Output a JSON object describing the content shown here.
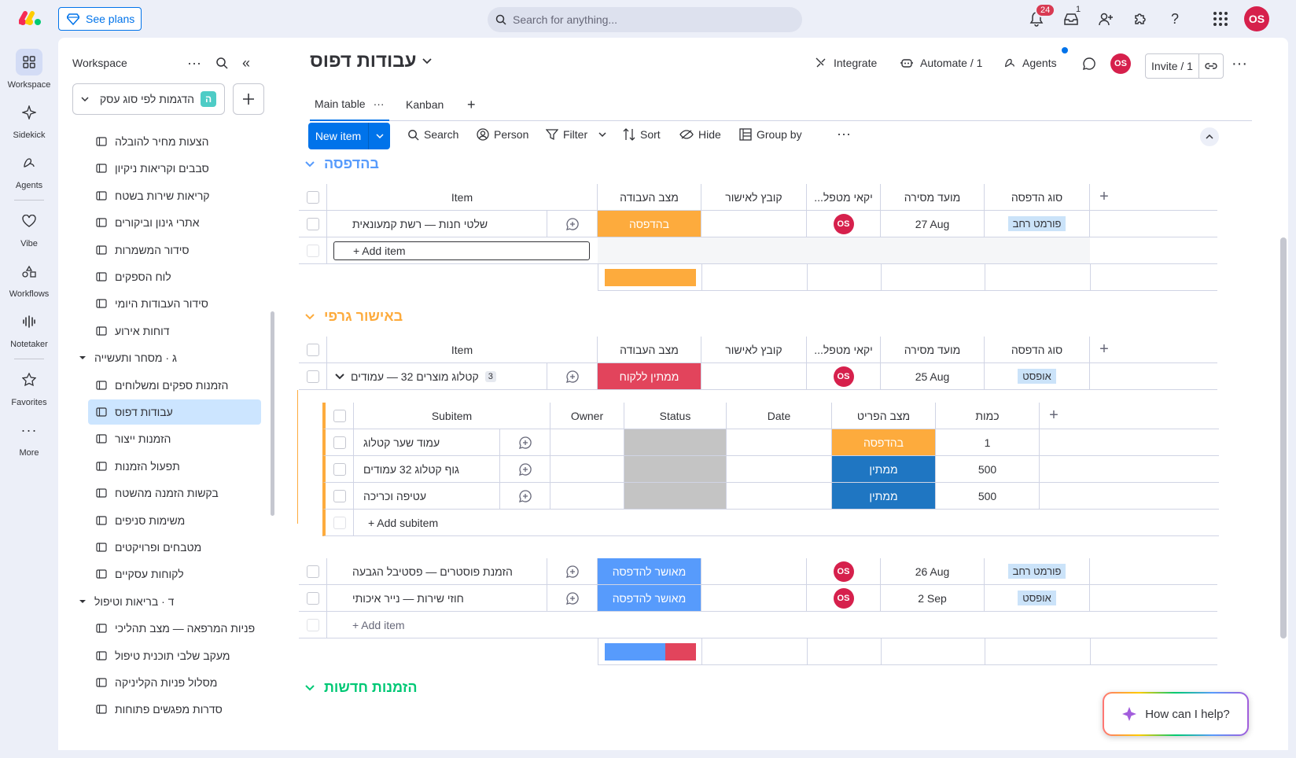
{
  "topbar": {
    "see_plans": "See plans",
    "search_placeholder": "Search for anything...",
    "notifications_count": "24",
    "inbox_count": "1",
    "user_initials": "OS"
  },
  "rail": {
    "items": [
      {
        "label": "Workspace",
        "icon": "grid-icon"
      },
      {
        "label": "Sidekick",
        "icon": "sparkle-icon"
      },
      {
        "label": "Agents",
        "icon": "agents-icon"
      },
      {
        "label": "Vibe",
        "icon": "heart-icon"
      },
      {
        "label": "Workflows",
        "icon": "workflows-icon"
      },
      {
        "label": "Notetaker",
        "icon": "waveform-icon"
      },
      {
        "label": "Favorites",
        "icon": "star-icon"
      },
      {
        "label": "More",
        "icon": "more-icon"
      }
    ]
  },
  "sidebar": {
    "title": "Workspace",
    "workspace_name": "הדגמות לפי סוג עסק",
    "workspace_badge": "ה",
    "items": [
      {
        "label": "הצעות מחיר להובלה",
        "type": "board"
      },
      {
        "label": "סבבים וקריאות ניקיון",
        "type": "board"
      },
      {
        "label": "קריאות שירות בשטח",
        "type": "board"
      },
      {
        "label": "אתרי גינון וביקורים",
        "type": "board"
      },
      {
        "label": "סידור המשמרות",
        "type": "board"
      },
      {
        "label": "לוח הספקים",
        "type": "board"
      },
      {
        "label": "סידור העבודות היומי",
        "type": "board"
      },
      {
        "label": "דוחות אירוע",
        "type": "board"
      },
      {
        "label": "ג · מסחר ותעשייה",
        "type": "group"
      },
      {
        "label": "הזמנות ספקים ומשלוחים",
        "type": "board"
      },
      {
        "label": "עבודות דפוס",
        "type": "board",
        "active": true
      },
      {
        "label": "הזמנות ייצור",
        "type": "board"
      },
      {
        "label": "תפעול הזמנות",
        "type": "board"
      },
      {
        "label": "בקשות הזמנה מהשטח",
        "type": "board"
      },
      {
        "label": "משימות סניפים",
        "type": "board"
      },
      {
        "label": "מטבחים ופרויקטים",
        "type": "board"
      },
      {
        "label": "לקוחות עסקיים",
        "type": "board"
      },
      {
        "label": "ד · בריאות וטיפול",
        "type": "group"
      },
      {
        "label": "פניות המרפאה — מצב תהליכי",
        "type": "board"
      },
      {
        "label": "מעקב שלבי תוכנית טיפול",
        "type": "board"
      },
      {
        "label": "מסלול פניות הקליניקה",
        "type": "board"
      },
      {
        "label": "סדרות מפגשים פתוחות",
        "type": "board"
      }
    ]
  },
  "board": {
    "title": "עבודות דפוס",
    "integrate": "Integrate",
    "automate": "Automate / 1",
    "agents": "Agents",
    "invite": "Invite / 1",
    "tabs": [
      "Main table",
      "Kanban"
    ],
    "toolbar": {
      "new_item": "New item",
      "search": "Search",
      "person": "Person",
      "filter": "Filter",
      "sort": "Sort",
      "hide": "Hide",
      "group_by": "Group by"
    },
    "columns": [
      "Item",
      "מצב העבודה",
      "קובץ לאישור",
      "...יקאי מטפל",
      "מועד מסירה",
      "סוג הדפסה"
    ],
    "add_item": "+ Add item",
    "groups": [
      {
        "title": "בהדפסה",
        "color": "#579bfc",
        "rows": [
          {
            "name": "שלטי חנות — רשת קמעונאית",
            "status": "בהדפסה",
            "status_color": "#fdab3d",
            "owner": "OS",
            "date": "27 Aug",
            "type": "פורמט רחב"
          }
        ]
      },
      {
        "title": "באישור גרפי",
        "color": "#fdab3d",
        "rows": [
          {
            "name": "קטלוג מוצרים 32 — עמודים",
            "subitems_count": "3",
            "status": "ממתין ללקוח",
            "status_color": "#e2445c",
            "owner": "OS",
            "date": "25 Aug",
            "type": "אופסט"
          },
          {
            "name": "הזמנת פוסטרים — פסטיבל הגבעה",
            "status": "מאושר להדפסה",
            "status_color": "#579bfc",
            "owner": "OS",
            "date": "26 Aug",
            "type": "פורמט רחב"
          },
          {
            "name": "חוזי שירות — נייר איכותי",
            "status": "מאושר להדפסה",
            "status_color": "#579bfc",
            "owner": "OS",
            "date": "2 Sep",
            "type": "אופסט"
          }
        ],
        "subitems": {
          "columns": [
            "Subitem",
            "Owner",
            "Status",
            "Date",
            "מצב הפריט",
            "כמות"
          ],
          "rows": [
            {
              "name": "עמוד שער קטלוג",
              "state": "בהדפסה",
              "state_color": "#fdab3d",
              "qty": "1"
            },
            {
              "name": "גוף קטלוג 32 עמודים",
              "state": "ממתין",
              "state_color": "#1f76c2",
              "qty": "500"
            },
            {
              "name": "עטיפה וכריכה",
              "state": "ממתין",
              "state_color": "#1f76c2",
              "qty": "500"
            }
          ],
          "add_subitem": "+ Add subitem"
        }
      },
      {
        "title": "הזמנות חדשות",
        "color": "#00c875",
        "rows": []
      }
    ]
  },
  "help": {
    "label": "How can I help?"
  }
}
